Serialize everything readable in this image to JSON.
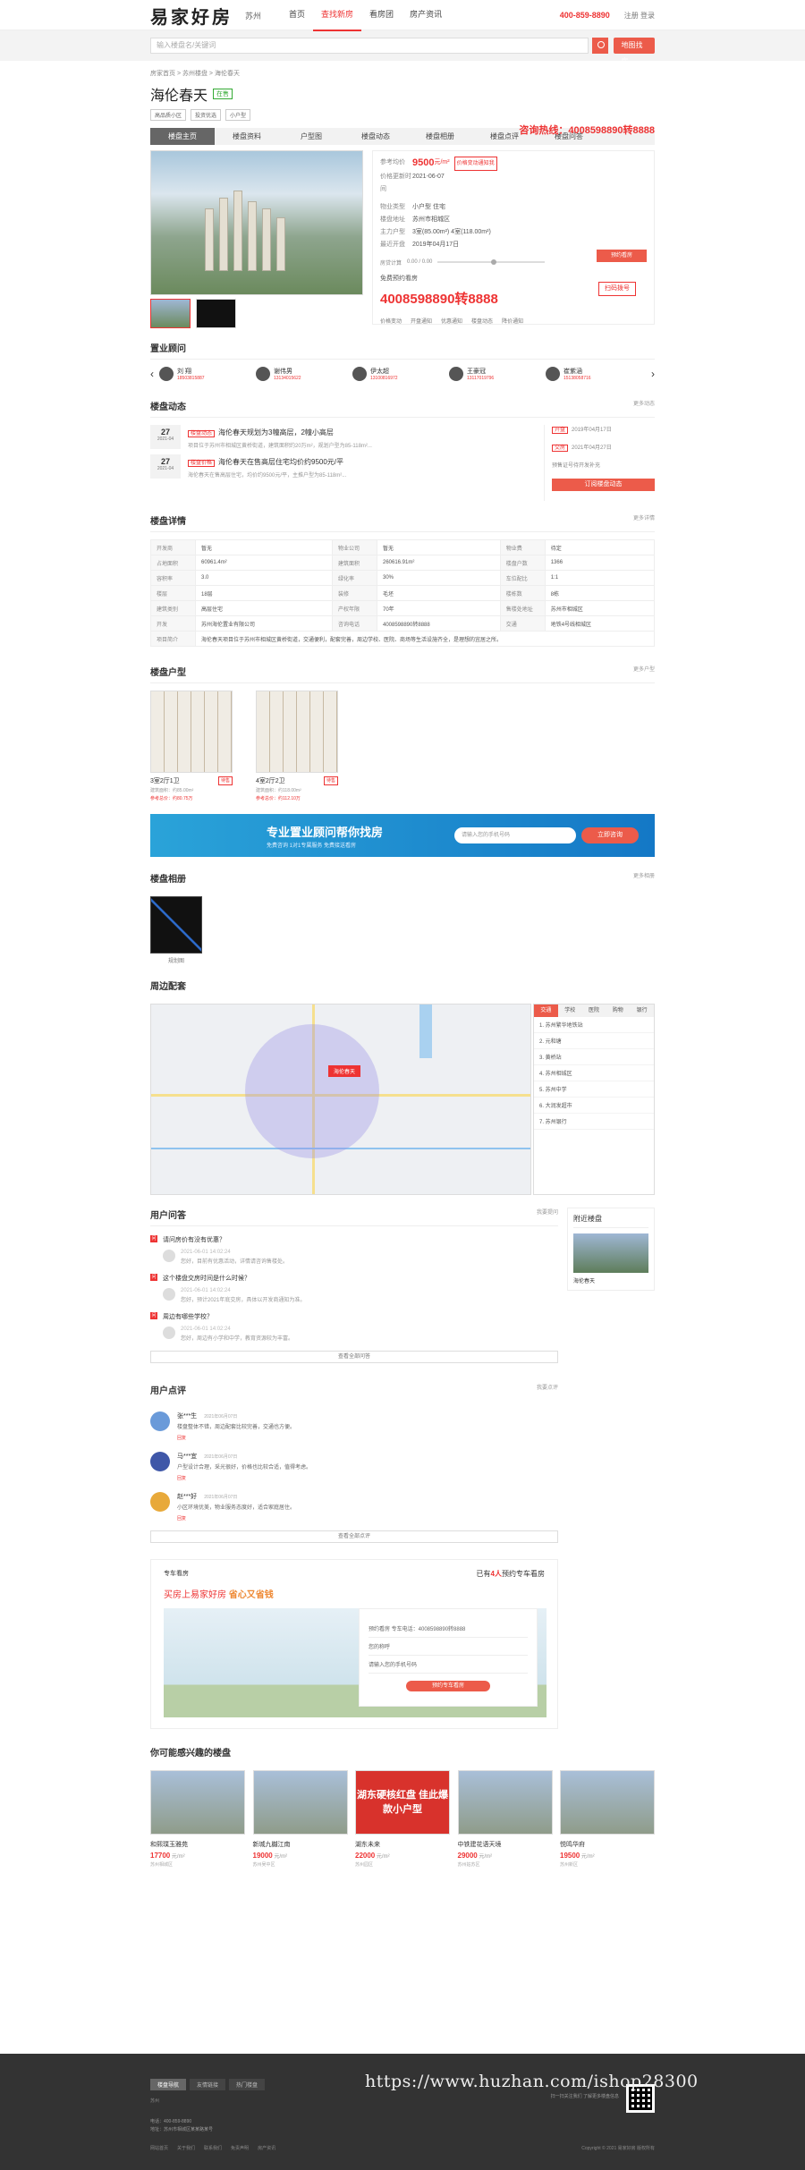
{
  "header": {
    "logo": "易家好房",
    "city": "苏州",
    "nav": [
      "首页",
      "查找新房",
      "看房团",
      "房产资讯"
    ],
    "phone": "400-859-8890",
    "login": "注册 登录"
  },
  "search": {
    "placeholder": "输入楼盘名/关键词",
    "map_btn": "地图找房"
  },
  "breadcrumb": "房家首页 > 苏州楼盘 > 海伦春天",
  "project": {
    "name": "海伦春天",
    "status": "在售",
    "tags": [
      "高品质小区",
      "投资优选",
      "小户型"
    ],
    "hotline": "咨询热线：4008598890转8888"
  },
  "tabs": [
    "楼盘主页",
    "楼盘资料",
    "户型图",
    "楼盘动态",
    "楼盘相册",
    "楼盘点评",
    "楼盘问答"
  ],
  "info": {
    "price_label": "参考均价",
    "price": "9500",
    "price_unit": "元/m²",
    "price_tag": "价格变动通知我",
    "date_label": "价格更新时间",
    "date": "2021-06-07",
    "type_label": "物业类型",
    "type": "小户型 住宅",
    "addr_label": "楼盘地址",
    "addr": "苏州市相城区",
    "house_label": "主力户型",
    "house": "3室(85.00m²)  4室(118.00m²)",
    "open_label": "最近开盘",
    "open": "2019年04月17日",
    "calc_label": "房贷计算",
    "calc": "0.00 / 0.00",
    "tel_text": "免费预约看房",
    "tel": "4008598890转8888",
    "sub_btn": "预约看房",
    "call_btn": "扫码拨号",
    "opts": [
      "价格变动",
      "开盘通知",
      "优惠通知",
      "楼盘动态",
      "降价通知"
    ]
  },
  "agents_title": "置业顾问",
  "agents": [
    {
      "name": "刘 翔",
      "phone": "18503815887"
    },
    {
      "name": "谢伟男",
      "phone": "13134015622"
    },
    {
      "name": "伊太超",
      "phone": "13100816972"
    },
    {
      "name": "王豪冠",
      "phone": "13117019796"
    },
    {
      "name": "崔紫涵",
      "phone": "15138058716"
    }
  ],
  "news_title": "楼盘动态",
  "news_more": "更多动态",
  "news": [
    {
      "day": "27",
      "ym": "2021-04",
      "tag": "楼盘动态",
      "title": "海伦春天规划为3幢高层，2幢小高层",
      "desc": "项目位于苏州市相城区黄桥街道，建筑面积约20万m²，规划户型为85-118m²..."
    },
    {
      "day": "27",
      "ym": "2021-04",
      "tag": "楼盘价格",
      "title": "海伦春天在售高层住宅均价约9500元/平",
      "desc": "海伦春天在售高层住宅，均价约9500元/平，主推户型为85-118m²..."
    }
  ],
  "news_side": [
    {
      "tag": "开盘",
      "text": "2019年04月17日"
    },
    {
      "tag": "交房",
      "text": "2021年04月27日"
    },
    {
      "tag": "",
      "text": "预售证号待开发补充"
    }
  ],
  "news_sub": "订阅楼盘动态",
  "detail_title": "楼盘详情",
  "detail_more": "更多详情",
  "detail": [
    [
      "开发商",
      "暂无",
      "物业公司",
      "暂无",
      "物业费",
      "待定"
    ],
    [
      "占地面积",
      "60961.4m²",
      "建筑面积",
      "260616.91m²",
      "楼盘户数",
      "1366"
    ],
    [
      "容积率",
      "3.0",
      "绿化率",
      "30%",
      "车位配比",
      "1:1"
    ],
    [
      "楼层",
      "18层",
      "装修",
      "毛坯",
      "楼栋数",
      "8栋"
    ],
    [
      "建筑类别",
      "高层住宅",
      "产权年限",
      "70年",
      "售楼处地址",
      "苏州市相城区"
    ],
    [
      "开发",
      "苏州海伦置业有限公司",
      "咨询电话",
      "4008598890转8888",
      "交通",
      "地铁4号线相城区"
    ],
    [
      "项目简介",
      "海伦春天项目位于苏州市相城区黄桥街道，交通便利，配套完善，周边学校、医院、商场等生活设施齐全，是理想的宜居之所。",
      "",
      "",
      "",
      ""
    ]
  ],
  "house_title": "楼盘户型",
  "house_more": "更多户型",
  "houses": [
    {
      "name": "3室2厅1卫",
      "tag": "待售",
      "area": "建筑面积：约85.00m²",
      "price": "参考总价：约80.75万"
    },
    {
      "name": "4室2厅2卫",
      "tag": "待售",
      "area": "建筑面积：约118.00m²",
      "price": "参考总价：约112.10万"
    }
  ],
  "banner": {
    "title": "专业置业顾问帮你找房",
    "sub": "免费咨询  1对1专属服务  免费接送看房",
    "input": "请输入您的手机号码",
    "btn": "立即咨询"
  },
  "album_title": "楼盘相册",
  "album_more": "更多相册",
  "album_cap": "规划图",
  "map_title": "周边配套",
  "map_marker": "海伦春天",
  "map_tabs": [
    "交通",
    "学校",
    "医院",
    "购物",
    "银行"
  ],
  "map_list": [
    "1. 苏州繁华地铁站",
    "2. 元和塘",
    "3. 黄桥站",
    "4. 苏州相城区",
    "5. 苏州中学",
    "6. 大润发超市",
    "7. 苏州银行"
  ],
  "qa_title": "用户问答",
  "qa_ask": "我要提问",
  "qa": [
    {
      "q": "请问房价有没有优惠？",
      "date": "2021-06-01 14:02:24",
      "a": "您好，目前有优惠活动，详情请咨询售楼处。"
    },
    {
      "q": "这个楼盘交房时间是什么时候？",
      "date": "2021-06-01 14:02:24",
      "a": "您好，预计2021年底交房，具体以开发商通知为准。"
    },
    {
      "q": "周边有哪些学校？",
      "date": "2021-06-01 14:02:24",
      "a": "您好，周边有小学和中学，教育资源较为丰富。"
    }
  ],
  "qa_more": "查看全部问答",
  "side": {
    "title": "附近楼盘",
    "name": "海伦春天"
  },
  "cmt_title": "用户点评",
  "cmt_btn": "我要点评",
  "comments": [
    {
      "name": "张***生",
      "date": "2021年06月07日",
      "text": "楼盘整体不错，周边配套比较完善，交通也方便。",
      "reply": "回复"
    },
    {
      "name": "马***宜",
      "date": "2021年06月07日",
      "text": "户型设计合理，采光很好，价格也比较合适，值得考虑。",
      "reply": "回复"
    },
    {
      "name": "赵***好",
      "date": "2021年06月07日",
      "text": "小区环境优美，物业服务态度好，适合家庭居住。",
      "reply": "回复"
    }
  ],
  "cmt_more": "查看全部点评",
  "car": {
    "t1": "专车看房",
    "t2_a": "已有",
    "count": "4人",
    "t2_b": "预约专车看房",
    "t3_a": "买房上易家好房",
    "t3_b": "省心又省钱",
    "hot": "预约看房 专车电话：4008598890转8888",
    "f1": "您的称呼",
    "f2": "请输入您的手机号码",
    "btn": "预约专车看房"
  },
  "like_title": "你可能感兴趣的楼盘",
  "likes": [
    {
      "name": "和熙璞玉雅苑",
      "price": "17700",
      "unit": "元/m²",
      "sub": "苏州相城区"
    },
    {
      "name": "新城九樾江南",
      "price": "19000",
      "unit": "元/m²",
      "sub": "苏州吴中区"
    },
    {
      "name": "湖东未来",
      "price": "22000",
      "unit": "元/m²",
      "sub": "苏州园区",
      "banner": "湖东硬核红盘 佳此爆款小户型"
    },
    {
      "name": "中铁建花语天境",
      "price": "29000",
      "unit": "元/m²",
      "sub": "苏州姑苏区"
    },
    {
      "name": "悦鸣华府",
      "price": "19500",
      "unit": "元/m²",
      "sub": "苏州新区"
    }
  ],
  "footer": {
    "tabs": [
      "楼盘导航",
      "友情链接",
      "热门楼盘"
    ],
    "link": "苏州",
    "info1": "电话：400-859-8890",
    "info2": "地址：苏州市相城区某某路某号",
    "qr": "扫一扫关注我们 了解更多楼盘信息",
    "links": [
      "网站首页",
      "关于我们",
      "联系我们",
      "免责声明",
      "房产资讯"
    ],
    "copy": "Copyright © 2021 易家好房 版权所有"
  },
  "watermark": "https://www.huzhan.com/ishop28300"
}
